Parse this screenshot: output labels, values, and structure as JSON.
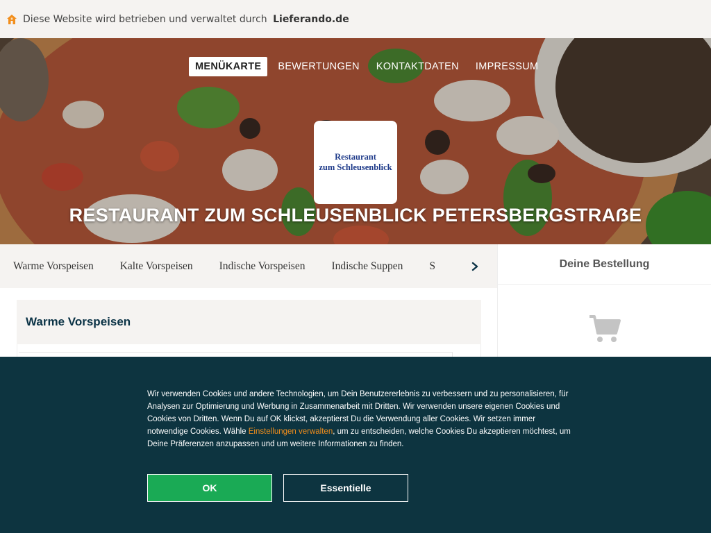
{
  "topbar": {
    "notice": "Diese Website wird betrieben und verwaltet durch",
    "brand": "Lieferando.de",
    "icon": "home-icon",
    "icon_color": "#f28e1c"
  },
  "nav": {
    "items": [
      {
        "label": "MENÜKARTE",
        "active": true
      },
      {
        "label": "BEWERTUNGEN",
        "active": false
      },
      {
        "label": "KONTAKTDATEN",
        "active": false
      },
      {
        "label": "IMPRESSUM",
        "active": false
      }
    ]
  },
  "logo": {
    "line1": "Restaurant",
    "line2": "zum Schleusenblick"
  },
  "hero": {
    "title": "RESTAURANT ZUM SCHLEUSENBLICK PETERSBERGSTRAẞE"
  },
  "categories": {
    "items": [
      "Warme Vorspeisen",
      "Kalte Vorspeisen",
      "Indische Vorspeisen",
      "Indische Suppen",
      "S"
    ],
    "next_icon": "chevron-right-icon"
  },
  "main": {
    "section_title": "Warme Vorspeisen"
  },
  "sidebar": {
    "title": "Deine Bestellung",
    "icon": "cart-icon"
  },
  "cookie": {
    "text_before_link": "Wir verwenden Cookies und andere Technologien, um Dein Benutzererlebnis zu verbessern und zu personalisieren, für Analysen zur Optimierung und Werbung in Zusammenarbeit mit Dritten. Wir verwenden unsere eigenen Cookies und Cookies von Dritten. Wenn Du auf OK klickst, akzeptierst Du die Verwendung aller Cookies. Wir setzen immer notwendige Cookies. Wähle ",
    "link": "Einstellungen verwalten",
    "text_after_link": ", um zu entscheiden, welche Cookies Du akzeptieren möchtest, um Deine Präferenzen anzupassen und um weitere Informationen zu finden.",
    "ok_label": "OK",
    "essential_label": "Essentielle",
    "ok_color": "#1aaa55",
    "bg_color": "#0d3440"
  }
}
